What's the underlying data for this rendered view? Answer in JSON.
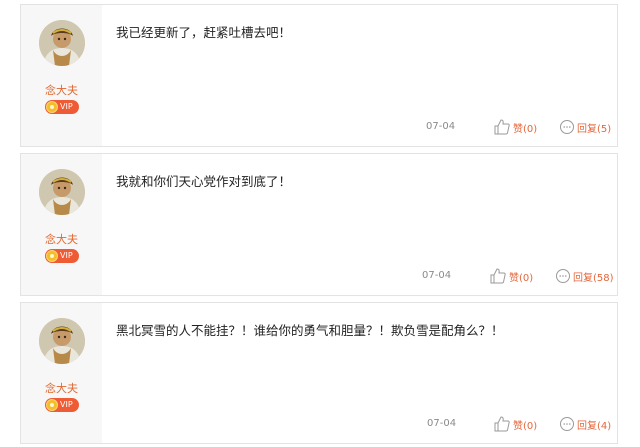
{
  "comments": [
    {
      "username": "念大夫",
      "vip_label": "VIP",
      "text": "我已经更新了，赶紧吐槽去吧！",
      "date": "07-04",
      "like_label": "赞(0)",
      "reply_label": "回复(5)"
    },
    {
      "username": "念大夫",
      "vip_label": "VIP",
      "text": "我就和你们天心党作对到底了！",
      "date": "07-04",
      "like_label": "赞(0)",
      "reply_label": "回复(58)"
    },
    {
      "username": "念大夫",
      "vip_label": "VIP",
      "text": "黑北冥雪的人不能挂？！谁给你的勇气和胆量？！欺负雪是配角么？！",
      "date": "07-04",
      "like_label": "赞(0)",
      "reply_label": "回复(4)"
    }
  ],
  "colors": {
    "username": "#e0672f",
    "action": "#e4663b",
    "vip_badge": "#ef5b34",
    "side_bg": "#f7f7f7",
    "border": "#e3e3e3"
  },
  "icons": [
    "avatar-image",
    "vip-coin-icon",
    "thumbs-up-icon",
    "reply-bubble-icon"
  ]
}
